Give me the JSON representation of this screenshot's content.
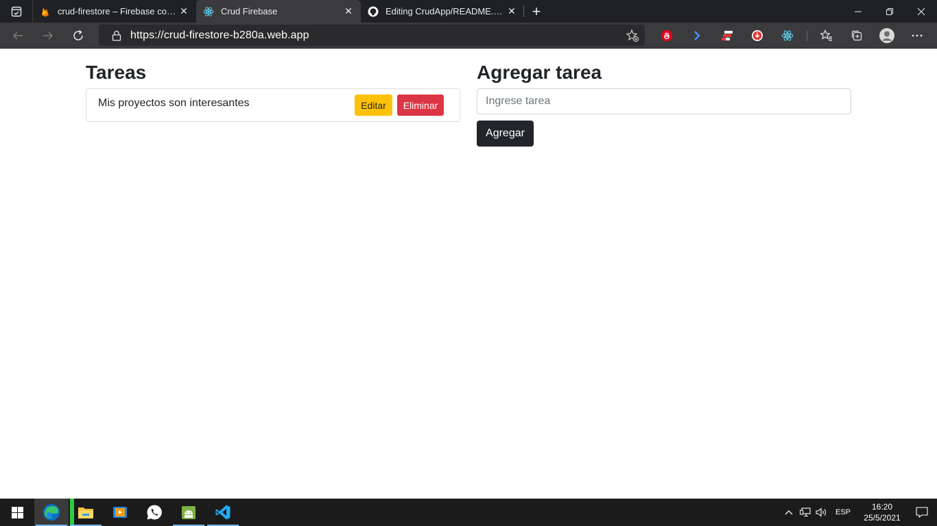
{
  "browser": {
    "tabs": [
      {
        "title": "crud-firestore – Firebase console",
        "icon": "firebase-icon",
        "active": false
      },
      {
        "title": "Crud Firebase",
        "icon": "react-icon",
        "active": true
      },
      {
        "title": "Editing CrudApp/README.md at",
        "icon": "github-icon",
        "active": false
      }
    ],
    "url": "https://crud-firestore-b280a.web.app",
    "colors": {
      "tabstrip": "#202124",
      "toolbar": "#3b3b3d",
      "omnibox": "#2a2a2c"
    }
  },
  "page": {
    "tasks_title": "Tareas",
    "tasks": [
      {
        "text": "Mis proyectos son interesantes",
        "edit_label": "Editar",
        "delete_label": "Eliminar"
      }
    ],
    "add_title": "Agregar tarea",
    "input_placeholder": "Ingrese tarea",
    "input_value": "",
    "add_label": "Agregar",
    "colors": {
      "edit": "#ffc107",
      "delete": "#dc3545",
      "add": "#212529"
    }
  },
  "taskbar": {
    "apps": [
      "edge-icon",
      "file-explorer-icon",
      "media-player-icon",
      "whatsapp-icon",
      "android-studio-icon",
      "vscode-icon"
    ],
    "language": "ESP",
    "time": "16:20",
    "date": "25/5/2021"
  }
}
